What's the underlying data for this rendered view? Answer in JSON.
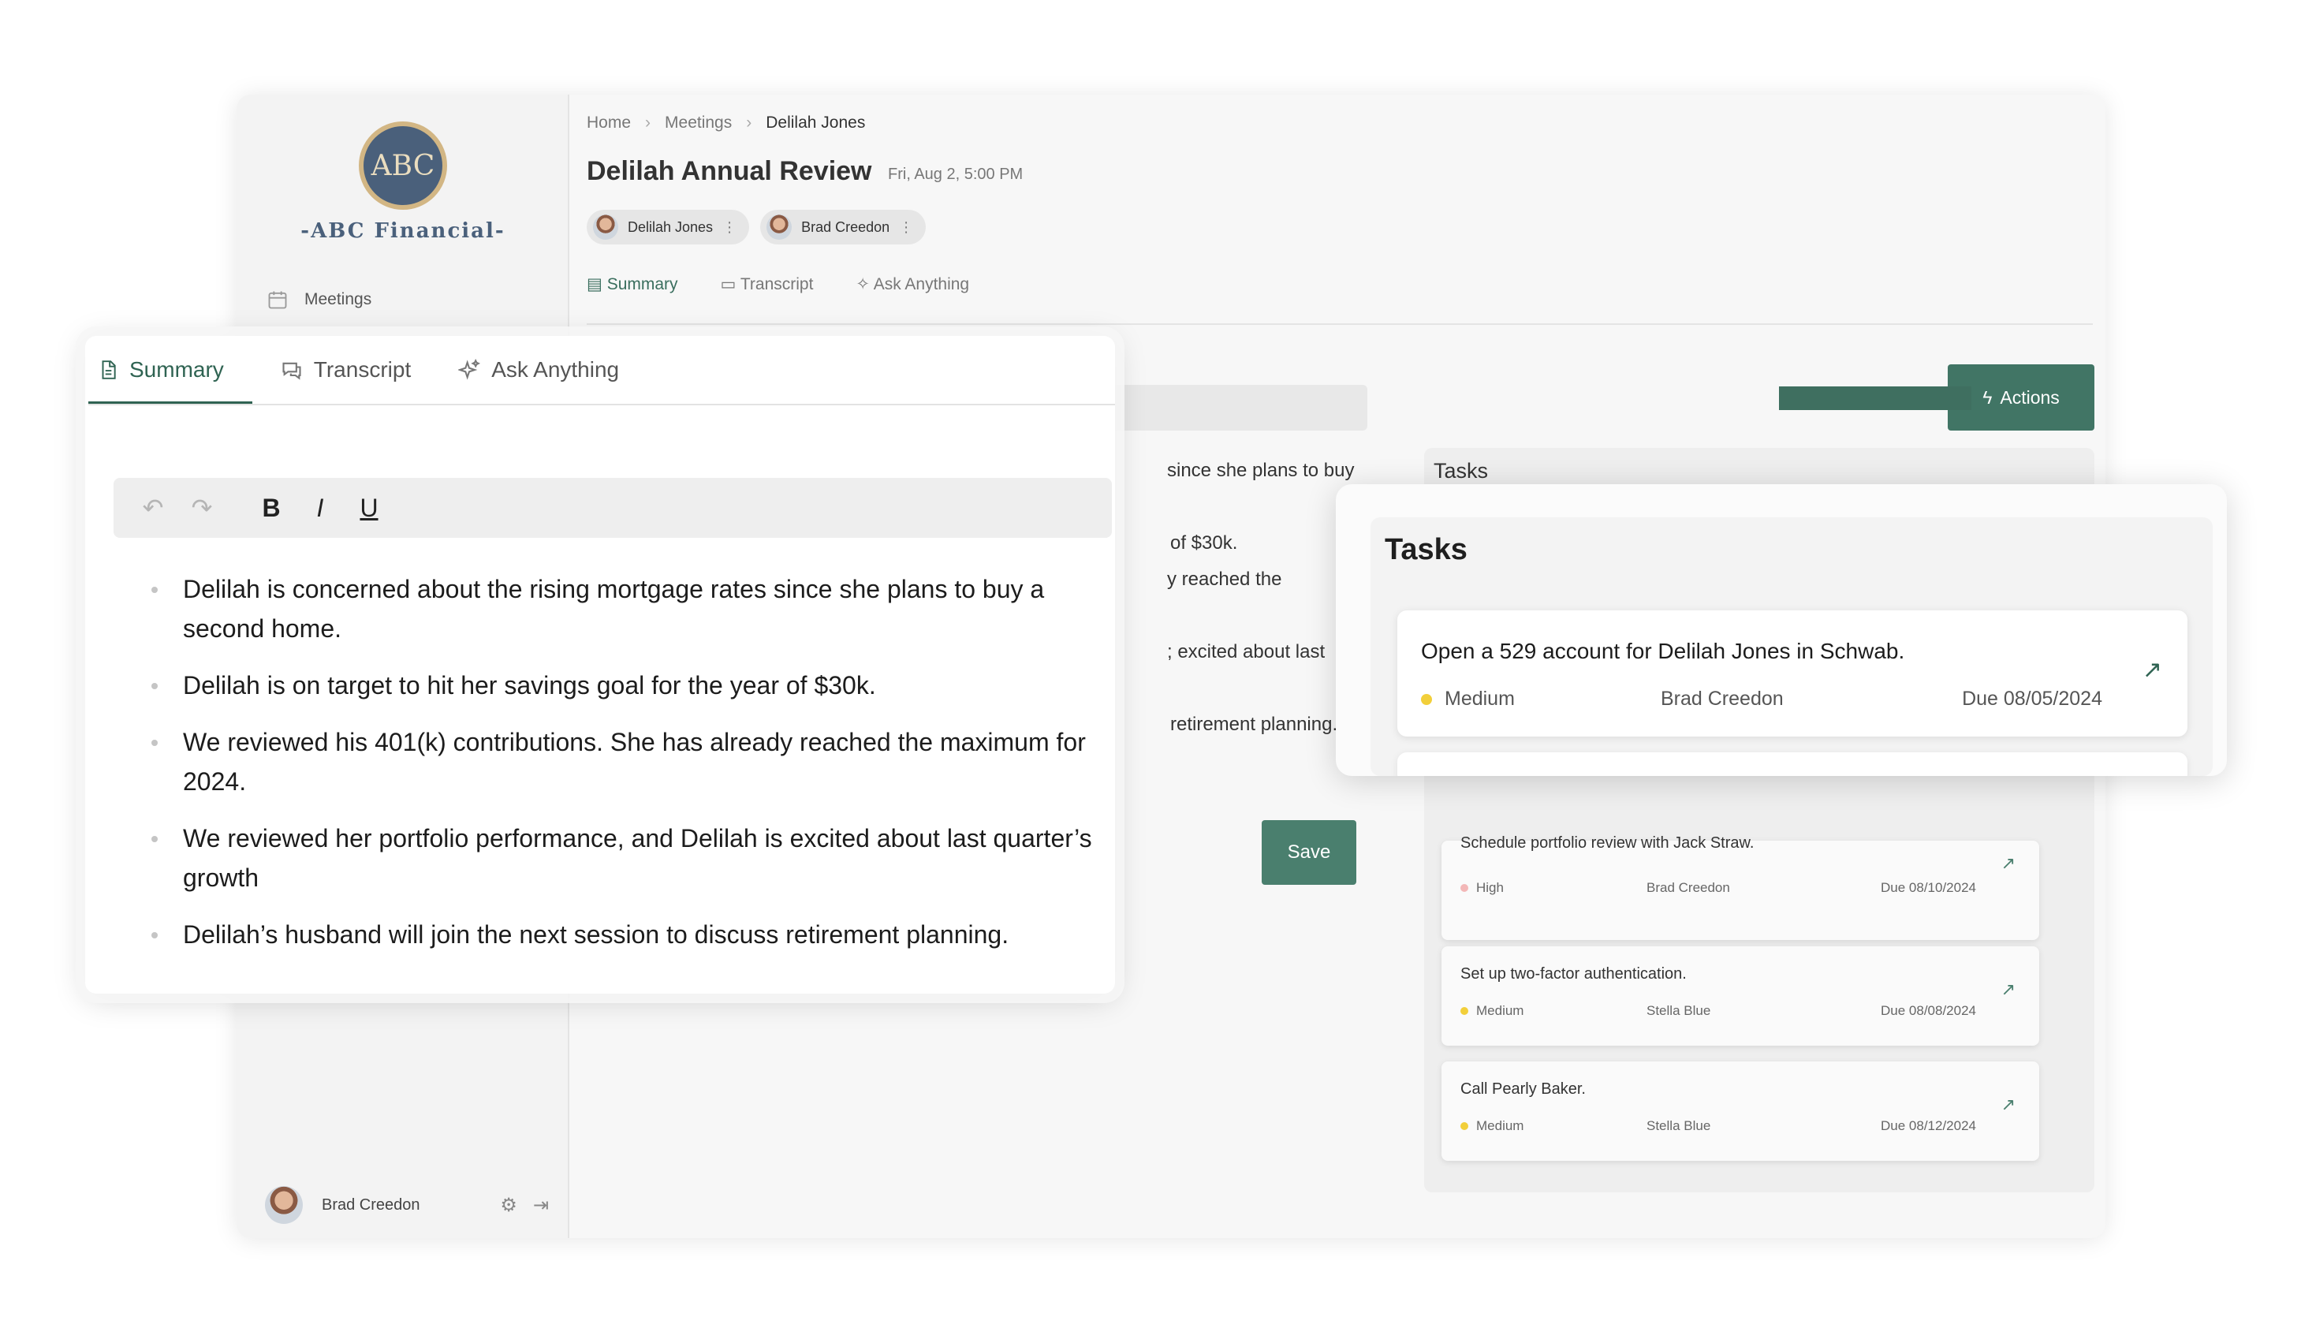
{
  "brand": {
    "logo_initials": "ABC",
    "name": "-ABC Financial-"
  },
  "sidebar": {
    "nav_meetings": "Meetings",
    "user_name": "Brad Creedon"
  },
  "breadcrumb": [
    "Home",
    "Meetings",
    "Delilah Jones"
  ],
  "meeting": {
    "title": "Delilah Annual Review",
    "datetime": "Fri, Aug 2, 5:00 PM",
    "participants": [
      "Delilah Jones",
      "Brad Creedon"
    ]
  },
  "tabs": [
    "Summary",
    "Transcript",
    "Ask Anything"
  ],
  "buttons": {
    "actions": "Actions",
    "save": "Save"
  },
  "background_summary_fragments": [
    "since she plans to buy",
    "of $30k.",
    "y reached the",
    "",
    "; excited about last",
    "",
    "retirement planning."
  ],
  "summary_notes": [
    "Delilah is concerned about the rising mortgage rates since she plans to buy a second home.",
    "Delilah is on target to hit her savings goal for the year of $30k.",
    "We reviewed his 401(k) contributions. She has already reached the maximum for 2024.",
    "We reviewed her portfolio performance, and Delilah is excited about last quarter’s growth",
    "Delilah’s husband will join the next session to discuss retirement planning."
  ],
  "toolbar": {
    "bold": "B",
    "italic": "I",
    "underline": "U"
  },
  "tasks": {
    "title": "Tasks",
    "featured": {
      "title": "Open a 529 account for Delilah Jones in Schwab.",
      "priority": "Medium",
      "owner": "Brad Creedon",
      "due": "Due 08/05/2024",
      "priority_color": "#f2cf3a"
    },
    "items": [
      {
        "title": "Schedule portfolio review with Jack Straw.",
        "priority": "High",
        "owner": "Brad Creedon",
        "due": "Due 08/10/2024",
        "priority_color": "#f3b7b7"
      },
      {
        "title": "Set up two-factor authentication.",
        "priority": "Medium",
        "owner": "Stella Blue",
        "due": "Due 08/08/2024",
        "priority_color": "#f2cf3a"
      },
      {
        "title": "Call Pearly Baker.",
        "priority": "Medium",
        "owner": "Stella Blue",
        "due": "Due 08/12/2024",
        "priority_color": "#f2cf3a"
      }
    ]
  },
  "colors": {
    "accent": "#2f6352",
    "button": "#417565"
  }
}
